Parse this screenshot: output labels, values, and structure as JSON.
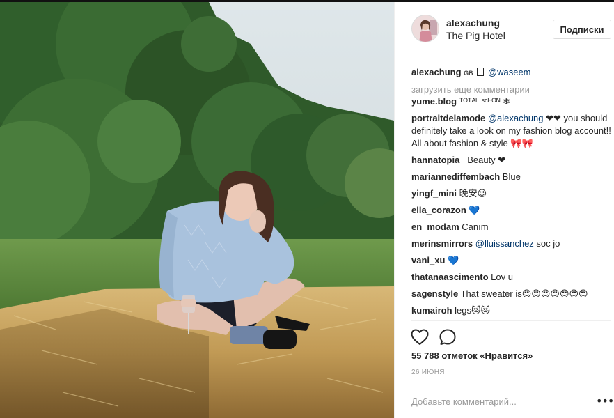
{
  "header": {
    "username": "alexachung",
    "location": "The Pig Hotel",
    "follow_label": "Подписки"
  },
  "caption": {
    "username": "alexachung",
    "badge": "GB",
    "mention": "@waseem"
  },
  "load_more": "загрузить еще комментарии",
  "comments": [
    {
      "user": "yume.blog",
      "text": "ᵀᴼᵀᴬᴸ ˢᶜᴴᴼᴺ ❄"
    },
    {
      "user": "portraitdelamode",
      "mention": "@alexachung",
      "text": " ❤❤ you should definitely take a look on my fashion blog account!! All about fashion & style 🎀🎀"
    },
    {
      "user": "hannatopia_",
      "text": "Beauty ❤"
    },
    {
      "user": "mariannediffembach",
      "text": "Blue"
    },
    {
      "user": "yingf_mini",
      "text": "晚安😉"
    },
    {
      "user": "ella_corazon",
      "text": "💙"
    },
    {
      "user": "en_modam",
      "text": "Canım"
    },
    {
      "user": "merinsmirrors",
      "mention": "@lluissanchez",
      "text": " soc jo"
    },
    {
      "user": "vani_xu",
      "text": "💙"
    },
    {
      "user": "thatanaascimento",
      "text": "Lov u"
    },
    {
      "user": "sagenstyle",
      "text": "That sweater is😍😍😍😍😍😍😍"
    },
    {
      "user": "kumairoh",
      "text": "legs😻😻"
    }
  ],
  "actions": {
    "like_icon": "heart-icon",
    "comment_icon": "comment-bubble-icon"
  },
  "likes": "55 788 отметок «Нравится»",
  "date": "26 ИЮНЯ",
  "comment_input": {
    "placeholder": "Добавьте комментарий..."
  },
  "more_label": "•••",
  "colors": {
    "text": "#262626",
    "muted": "#999999",
    "link": "#003569",
    "border": "#dbdbdb"
  }
}
